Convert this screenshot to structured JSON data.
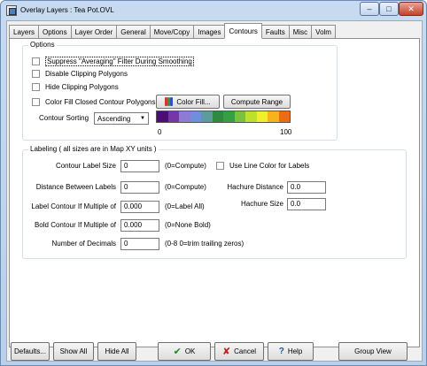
{
  "window": {
    "title": "Overlay Layers : Tea Pot.OVL",
    "controls": {
      "minimize": "–",
      "maximize": "□",
      "close": "✕"
    }
  },
  "tabs": [
    {
      "label": "Layers"
    },
    {
      "label": "Options"
    },
    {
      "label": "Layer Order"
    },
    {
      "label": "General"
    },
    {
      "label": "Move/Copy"
    },
    {
      "label": "Images"
    },
    {
      "label": "Contours",
      "active": true
    },
    {
      "label": "Faults"
    },
    {
      "label": "Misc"
    },
    {
      "label": "Volm"
    }
  ],
  "options": {
    "legend": "Options",
    "suppress_filter": {
      "label": "Suppress \"Averaging\" Filter During Smoothing",
      "checked": false
    },
    "disable_clipping": {
      "label": "Disable Clipping Polygons",
      "checked": false
    },
    "hide_clipping": {
      "label": "Hide Clipping Polygons",
      "checked": false
    },
    "color_fill": {
      "label": "Color Fill Closed Contour Polygons",
      "checked": false
    },
    "color_fill_button": "Color Fill...",
    "compute_range_button": "Compute Range",
    "sorting_label": "Contour Sorting",
    "sorting_value": "Ascending",
    "colorbar": {
      "min_label": "0",
      "max_label": "100",
      "colors": [
        "#4b0f73",
        "#7636a8",
        "#8f7bd6",
        "#6f8fde",
        "#5c9c9c",
        "#2e8a3e",
        "#34a042",
        "#79c23a",
        "#bfe02a",
        "#f2ee2a",
        "#f7b21c",
        "#ef6a12"
      ]
    }
  },
  "labeling": {
    "legend": "Labeling  ( all sizes are in Map XY units )",
    "contour_label_size": {
      "label": "Contour Label Size",
      "value": "0",
      "hint": "(0=Compute)"
    },
    "use_line_color": {
      "label": "Use Line Color for Labels",
      "checked": false
    },
    "distance_between": {
      "label": "Distance Between Labels",
      "value": "0",
      "hint": "(0=Compute)"
    },
    "hachure_distance": {
      "label": "Hachure Distance",
      "value": "0.0"
    },
    "label_multiple": {
      "label": "Label Contour If Multiple of",
      "value": "0.000",
      "hint": "(0=Label All)"
    },
    "hachure_size": {
      "label": "Hachure Size",
      "value": "0.0"
    },
    "bold_multiple": {
      "label": "Bold Contour If Multiple of",
      "value": "0.000",
      "hint": "(0=None Bold)"
    },
    "num_decimals": {
      "label": "Number of Decimals",
      "value": "0",
      "hint": "(0-8  0=trim trailing zeros)"
    }
  },
  "footer": {
    "defaults": "Defaults...",
    "show_all": "Show All",
    "hide_all": "Hide All",
    "ok": "OK",
    "cancel": "Cancel",
    "help": "Help",
    "group_view": "Group View"
  }
}
